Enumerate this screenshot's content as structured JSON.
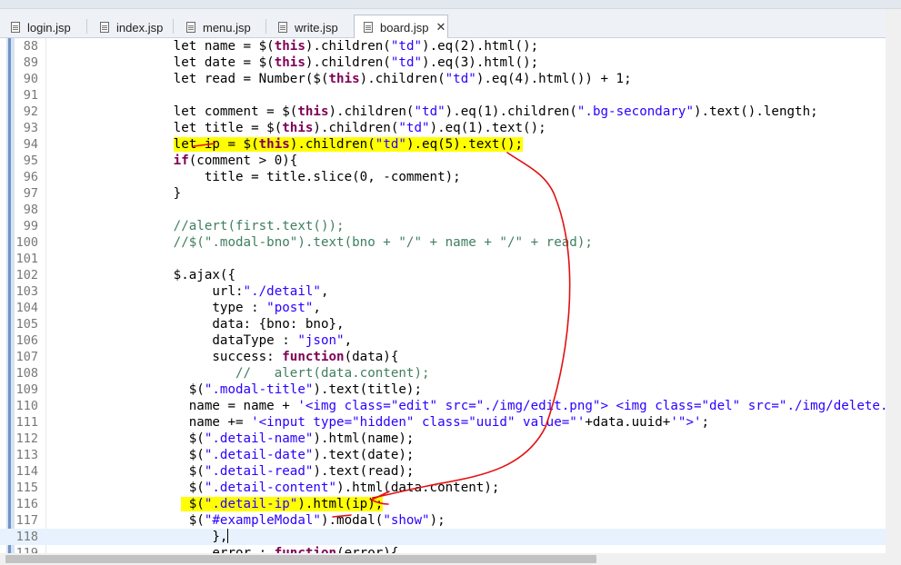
{
  "tabs": [
    {
      "label": "login.jsp"
    },
    {
      "label": "index.jsp"
    },
    {
      "label": "menu.jsp"
    },
    {
      "label": "write.jsp"
    },
    {
      "label": "board.jsp",
      "active": true
    }
  ],
  "close_glyph": "✕",
  "lines": [
    {
      "n": "88",
      "tokens": [
        {
          "t": "                let name = $("
        },
        {
          "t": "this",
          "c": "kw"
        },
        {
          "t": ").children("
        },
        {
          "t": "\"td\"",
          "c": "str"
        },
        {
          "t": ").eq(2).html();"
        }
      ]
    },
    {
      "n": "89",
      "tokens": [
        {
          "t": "                let date = $("
        },
        {
          "t": "this",
          "c": "kw"
        },
        {
          "t": ").children("
        },
        {
          "t": "\"td\"",
          "c": "str"
        },
        {
          "t": ").eq(3).html();"
        }
      ]
    },
    {
      "n": "90",
      "tokens": [
        {
          "t": "                let read = Number($("
        },
        {
          "t": "this",
          "c": "kw"
        },
        {
          "t": ").children("
        },
        {
          "t": "\"td\"",
          "c": "str"
        },
        {
          "t": ").eq(4).html()) + 1;"
        }
      ]
    },
    {
      "n": "91",
      "tokens": []
    },
    {
      "n": "92",
      "tokens": [
        {
          "t": "                let comment = $("
        },
        {
          "t": "this",
          "c": "kw"
        },
        {
          "t": ").children("
        },
        {
          "t": "\"td\"",
          "c": "str"
        },
        {
          "t": ").eq(1).children("
        },
        {
          "t": "\".bg-secondary\"",
          "c": "str"
        },
        {
          "t": ").text().length;"
        }
      ]
    },
    {
      "n": "93",
      "tokens": [
        {
          "t": "                let title = $("
        },
        {
          "t": "this",
          "c": "kw"
        },
        {
          "t": ").children("
        },
        {
          "t": "\"td\"",
          "c": "str"
        },
        {
          "t": ").eq(1).text();"
        }
      ]
    },
    {
      "n": "94",
      "hl": true,
      "tokens": [
        {
          "t": "                "
        },
        {
          "t": "let ip = $(",
          "h": true
        },
        {
          "t": "this",
          "c": "kw",
          "h": true
        },
        {
          "t": ").children(",
          "h": true
        },
        {
          "t": "\"td\"",
          "c": "str",
          "h": true
        },
        {
          "t": ").eq(5).text();",
          "h": true
        }
      ]
    },
    {
      "n": "95",
      "tokens": [
        {
          "t": "                "
        },
        {
          "t": "if",
          "c": "kw"
        },
        {
          "t": "(comment > 0){"
        }
      ]
    },
    {
      "n": "96",
      "tokens": [
        {
          "t": "                    title = title.slice(0, -comment);"
        }
      ]
    },
    {
      "n": "97",
      "tokens": [
        {
          "t": "                }"
        }
      ]
    },
    {
      "n": "98",
      "tokens": []
    },
    {
      "n": "99",
      "tokens": [
        {
          "t": "                "
        },
        {
          "t": "//alert(first.text());",
          "c": "cmt"
        }
      ]
    },
    {
      "n": "100",
      "tokens": [
        {
          "t": "                "
        },
        {
          "t": "//$(\".modal-bno\").text(bno + \"/\" + name + \"/\" + read);",
          "c": "cmt"
        }
      ]
    },
    {
      "n": "101",
      "tokens": []
    },
    {
      "n": "102",
      "tokens": [
        {
          "t": "                $.ajax({"
        }
      ]
    },
    {
      "n": "103",
      "tokens": [
        {
          "t": "                     url:"
        },
        {
          "t": "\"./detail\"",
          "c": "str"
        },
        {
          "t": ","
        }
      ]
    },
    {
      "n": "104",
      "tokens": [
        {
          "t": "                     type : "
        },
        {
          "t": "\"post\"",
          "c": "str"
        },
        {
          "t": ","
        }
      ]
    },
    {
      "n": "105",
      "tokens": [
        {
          "t": "                     data: {bno: bno},"
        }
      ]
    },
    {
      "n": "106",
      "tokens": [
        {
          "t": "                     dataType : "
        },
        {
          "t": "\"json\"",
          "c": "str"
        },
        {
          "t": ","
        }
      ]
    },
    {
      "n": "107",
      "tokens": [
        {
          "t": "                     success: "
        },
        {
          "t": "function",
          "c": "kw"
        },
        {
          "t": "(data){"
        }
      ]
    },
    {
      "n": "108",
      "tokens": [
        {
          "t": "                        "
        },
        {
          "t": "//   alert(data.content);",
          "c": "cmt"
        }
      ]
    },
    {
      "n": "109",
      "tokens": [
        {
          "t": "                  $("
        },
        {
          "t": "\".modal-title\"",
          "c": "str"
        },
        {
          "t": ").text(title);"
        }
      ]
    },
    {
      "n": "110",
      "tokens": [
        {
          "t": "                  name = name + "
        },
        {
          "t": "'<img class=\"edit\" src=\"./img/edit.png\"> <img class=\"del\" src=\"./img/delete.png\">'",
          "c": "str"
        },
        {
          "t": "; n"
        }
      ]
    },
    {
      "n": "111",
      "tokens": [
        {
          "t": "                  name += "
        },
        {
          "t": "'<input type=\"hidden\" class=\"uuid\" value=\"'",
          "c": "str"
        },
        {
          "t": "+data.uuid+"
        },
        {
          "t": "'\">'",
          "c": "str"
        },
        {
          "t": ";"
        }
      ]
    },
    {
      "n": "112",
      "tokens": [
        {
          "t": "                  $("
        },
        {
          "t": "\".detail-name\"",
          "c": "str"
        },
        {
          "t": ").html(name);"
        }
      ]
    },
    {
      "n": "113",
      "tokens": [
        {
          "t": "                  $("
        },
        {
          "t": "\".detail-date\"",
          "c": "str"
        },
        {
          "t": ").text(date);"
        }
      ]
    },
    {
      "n": "114",
      "tokens": [
        {
          "t": "                  $("
        },
        {
          "t": "\".detail-read\"",
          "c": "str"
        },
        {
          "t": ").text(read);"
        }
      ]
    },
    {
      "n": "115",
      "tokens": [
        {
          "t": "                  $("
        },
        {
          "t": "\".detail-content\"",
          "c": "str"
        },
        {
          "t": ").html(data.content);"
        }
      ]
    },
    {
      "n": "116",
      "hl": true,
      "tokens": [
        {
          "t": "                 "
        },
        {
          "t": " $(",
          "h": true
        },
        {
          "t": "\".detail-ip\"",
          "c": "str",
          "h": true
        },
        {
          "t": ").html(ip);",
          "h": true
        }
      ]
    },
    {
      "n": "117",
      "tokens": [
        {
          "t": "                  $("
        },
        {
          "t": "\"#exampleModal\"",
          "c": "str"
        },
        {
          "t": ").modal("
        },
        {
          "t": "\"show\"",
          "c": "str"
        },
        {
          "t": ");"
        }
      ]
    },
    {
      "n": "118",
      "current": true,
      "caret": true,
      "tokens": [
        {
          "t": "                     },"
        }
      ]
    },
    {
      "n": "119",
      "tokens": [
        {
          "t": "                     error : "
        },
        {
          "t": "function",
          "c": "kw"
        },
        {
          "t": "(error){"
        }
      ]
    }
  ]
}
